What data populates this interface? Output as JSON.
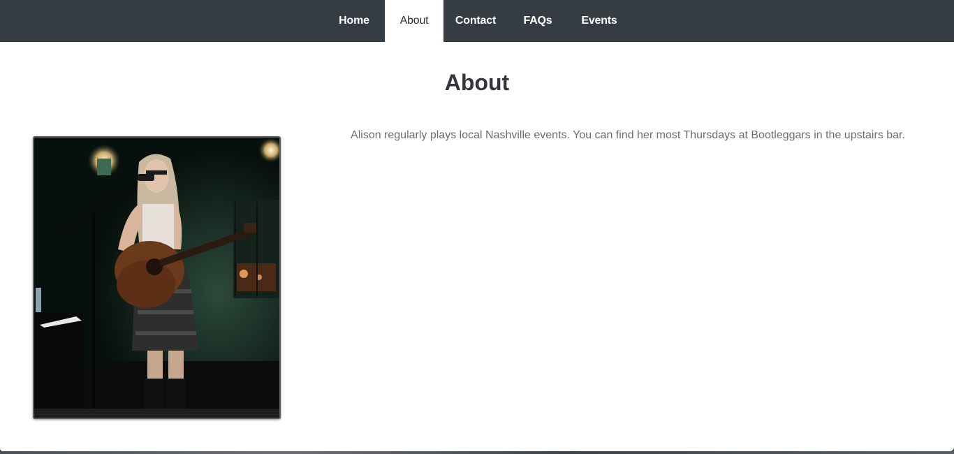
{
  "nav": {
    "items": [
      {
        "label": "Home",
        "active": false
      },
      {
        "label": "About",
        "active": true
      },
      {
        "label": "Contact",
        "active": false
      },
      {
        "label": "FAQs",
        "active": false
      },
      {
        "label": "Events",
        "active": false
      }
    ]
  },
  "main": {
    "title": "About",
    "photo_icon": "performer-photo",
    "description": "Alison regularly plays local Nashville events. You can find her most Thursdays at Bootleggars in the upstairs bar."
  },
  "colors": {
    "nav_bg": "#363c43",
    "nav_active_bg": "#ffffff",
    "title": "#33373c",
    "body_text": "#6a6e72"
  }
}
